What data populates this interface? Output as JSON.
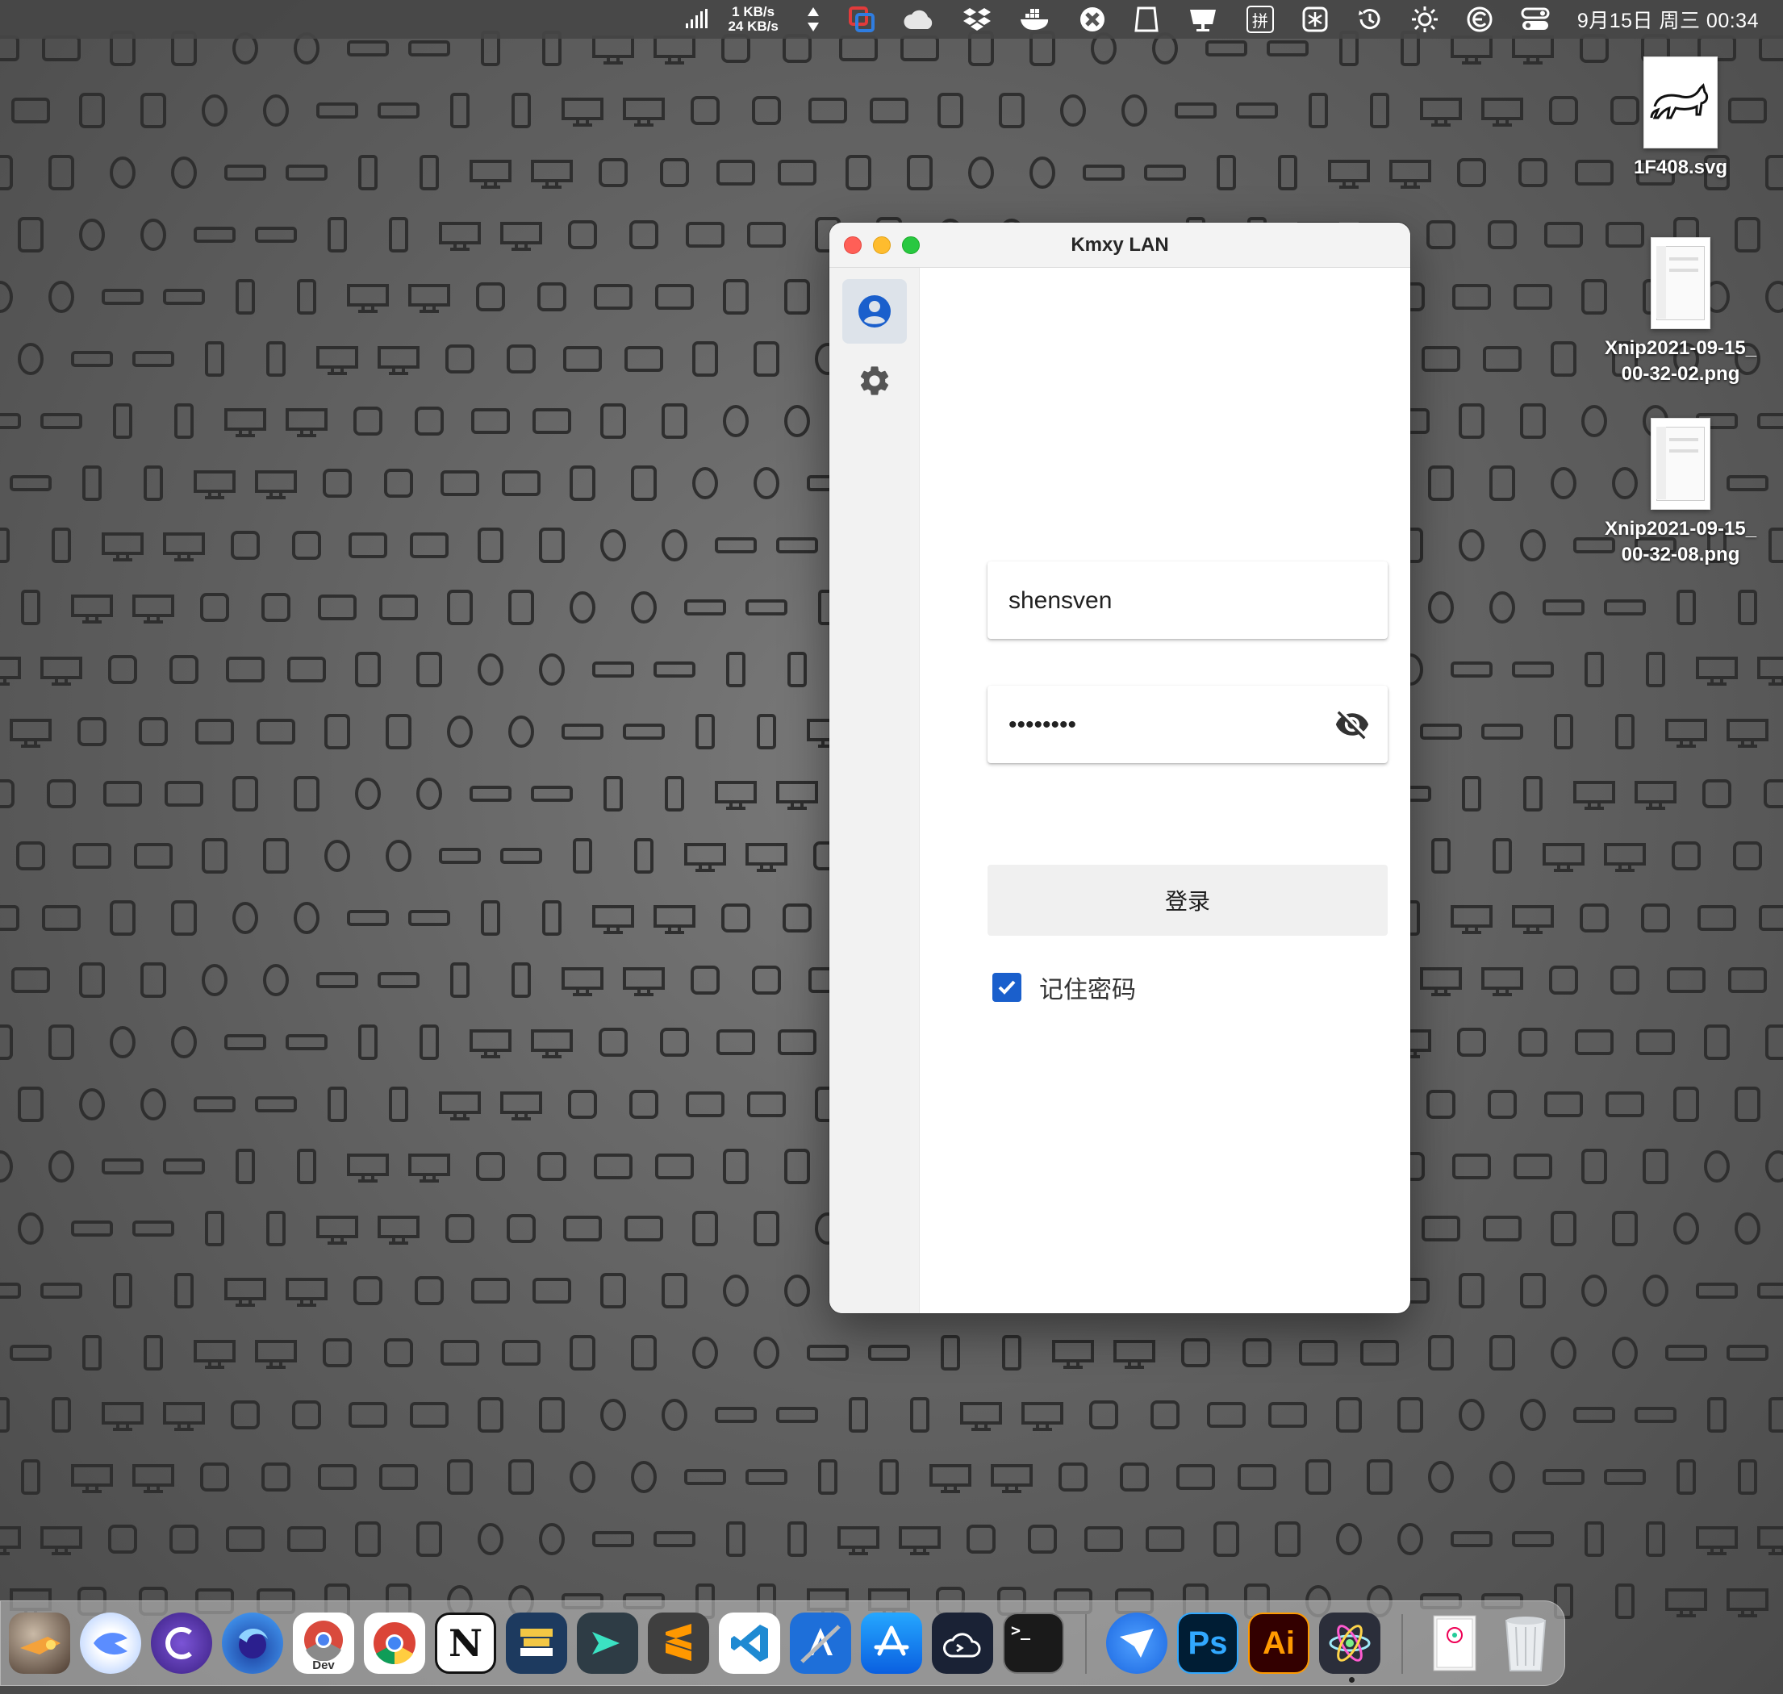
{
  "menubar": {
    "net_up": "1 KB/s",
    "net_down": "24 KB/s",
    "ime_label": "拼",
    "clock": "9月15日 周三  00:34",
    "icons": [
      "signal-bars-icon",
      "updown-arrows-icon",
      "parallels-icon",
      "cloud-icon",
      "dropbox-icon",
      "docker-icon",
      "app-switch-icon",
      "ipad-icon",
      "display-icon",
      "ime-icon",
      "snowflake-icon",
      "time-machine-icon",
      "brightness-icon",
      "ccleaner-icon",
      "control-center-icon"
    ]
  },
  "desktop": {
    "files": [
      {
        "name": "1F408.svg"
      },
      {
        "name": "Xnip2021-09-15_\n00-32-02.png"
      },
      {
        "name": "Xnip2021-09-15_\n00-32-08.png"
      }
    ]
  },
  "window": {
    "title": "Kmxy LAN",
    "sidebar": {
      "items": [
        {
          "icon": "account-circle-icon",
          "active": true
        },
        {
          "icon": "gear-icon",
          "active": false
        }
      ]
    },
    "form": {
      "username_value": "shensven",
      "password_value": "shensven",
      "password_toggle_icon": "eye-off-icon",
      "login_label": "登录",
      "remember_label": "记住密码",
      "remember_checked": true
    },
    "colors": {
      "accent": "#1a5fcc",
      "sidebar_active_bg": "#dde3ea"
    }
  },
  "dock": {
    "apps": [
      {
        "icon": "launcher-icon"
      },
      {
        "icon": "tweetbot-icon"
      },
      {
        "icon": "pock-icon"
      },
      {
        "icon": "firefox-icon"
      },
      {
        "icon": "chrome-dev-icon",
        "badge": "Dev"
      },
      {
        "icon": "chrome-icon"
      },
      {
        "icon": "notion-icon",
        "label": "N"
      },
      {
        "icon": "sublime-merge-icon"
      },
      {
        "icon": "prompt-icon"
      },
      {
        "icon": "sublime-text-icon"
      },
      {
        "icon": "vscode-icon"
      },
      {
        "icon": "xcode-icon"
      },
      {
        "icon": "app-store-icon"
      },
      {
        "icon": "cloud-terminal-icon"
      },
      {
        "icon": "terminal-icon",
        "label": ">_"
      },
      {
        "icon": "feishu-icon"
      },
      {
        "icon": "photoshop-icon",
        "label": "Ps"
      },
      {
        "icon": "illustrator-icon",
        "label": "Ai"
      },
      {
        "icon": "electron-icon"
      },
      {
        "icon": "documents-folder-icon"
      },
      {
        "icon": "trash-icon"
      }
    ]
  }
}
